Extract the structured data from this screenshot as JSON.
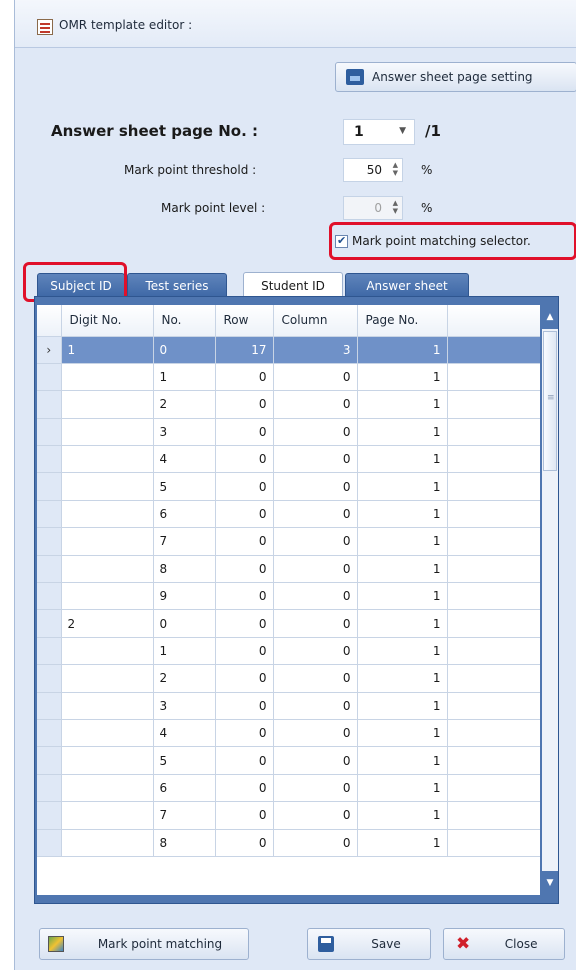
{
  "window": {
    "title": "OMR template editor :"
  },
  "toolbar": {
    "page_setting_label": "Answer sheet page setting"
  },
  "form": {
    "page_no_label": "Answer sheet page No. :",
    "page_no_value": "1",
    "page_total": "/1",
    "threshold_label": "Mark point threshold :",
    "threshold_value": "50",
    "threshold_unit": "%",
    "level_label": "Mark point level :",
    "level_value": "0",
    "level_unit": "%",
    "matching_selector_label": "Mark point matching selector.",
    "matching_selector_checked": true
  },
  "tabs": [
    {
      "label": "Subject ID",
      "active": false
    },
    {
      "label": "Test series",
      "active": false
    },
    {
      "label": "Student ID",
      "active": true
    },
    {
      "label": "Answer sheet",
      "active": false
    }
  ],
  "grid": {
    "columns": [
      "Digit No.",
      "No.",
      "Row",
      "Column",
      "Page No."
    ],
    "selected_marker": "›",
    "rows": [
      [
        "1",
        "0",
        "17",
        "3",
        "1"
      ],
      [
        "",
        "1",
        "0",
        "0",
        "1"
      ],
      [
        "",
        "2",
        "0",
        "0",
        "1"
      ],
      [
        "",
        "3",
        "0",
        "0",
        "1"
      ],
      [
        "",
        "4",
        "0",
        "0",
        "1"
      ],
      [
        "",
        "5",
        "0",
        "0",
        "1"
      ],
      [
        "",
        "6",
        "0",
        "0",
        "1"
      ],
      [
        "",
        "7",
        "0",
        "0",
        "1"
      ],
      [
        "",
        "8",
        "0",
        "0",
        "1"
      ],
      [
        "",
        "9",
        "0",
        "0",
        "1"
      ],
      [
        "2",
        "0",
        "0",
        "0",
        "1"
      ],
      [
        "",
        "1",
        "0",
        "0",
        "1"
      ],
      [
        "",
        "2",
        "0",
        "0",
        "1"
      ],
      [
        "",
        "3",
        "0",
        "0",
        "1"
      ],
      [
        "",
        "4",
        "0",
        "0",
        "1"
      ],
      [
        "",
        "5",
        "0",
        "0",
        "1"
      ],
      [
        "",
        "6",
        "0",
        "0",
        "1"
      ],
      [
        "",
        "7",
        "0",
        "0",
        "1"
      ],
      [
        "",
        "8",
        "0",
        "0",
        "1"
      ]
    ]
  },
  "buttons": {
    "mark_matching": "Mark point matching",
    "save": "Save",
    "close": "Close"
  },
  "icons": {
    "title": "template-editor-icon",
    "page_setting": "page-setting-icon",
    "mark_matching": "mark-matching-icon",
    "save": "floppy-disk-icon",
    "close": "red-x-icon"
  },
  "colors": {
    "tab_blue": "#3e68a6",
    "selected_row": "#6f91c8",
    "highlight_red": "#e0102a"
  }
}
